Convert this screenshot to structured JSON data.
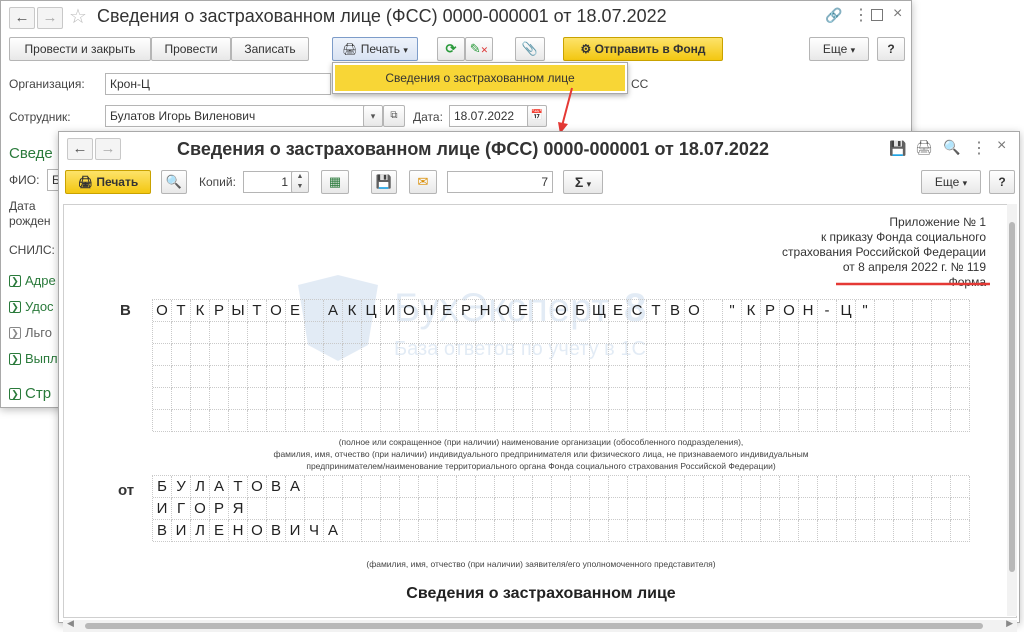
{
  "back_window": {
    "title": "Сведения о застрахованном лице (ФСС) 0000-000001 от 18.07.2022",
    "toolbar": {
      "post_close": "Провести и закрыть",
      "post": "Провести",
      "save": "Записать",
      "print": "Печать",
      "send_fund": "Отправить в Фонд",
      "more": "Еще",
      "help": "?"
    },
    "print_menu_item": "Сведения о застрахованном лице",
    "org_label": "Организация:",
    "org_value": "Крон-Ц",
    "org_suffix": "СС",
    "employee_label": "Сотрудник:",
    "employee_value": "Булатов Игорь Виленович",
    "date_label": "Дата:",
    "date_value": "18.07.2022",
    "section_title": "Сведе",
    "fio_label": "ФИО:",
    "fio_value": "Б",
    "birth_label_1": "Дата",
    "birth_label_2": "рожден",
    "snils_label": "СНИЛС:",
    "links": [
      "Адре",
      "Удос",
      "Льго",
      "Выпл",
      "Стр"
    ]
  },
  "front_window": {
    "title": "Сведения о застрахованном лице (ФСС) 0000-000001 от 18.07.2022",
    "toolbar": {
      "print": "Печать",
      "copies_label": "Копий:",
      "copies_value": "1",
      "page_value": "7",
      "sum_symbol": "Σ",
      "more": "Еще",
      "help": "?"
    },
    "document": {
      "appendix_lines": [
        "Приложение № 1",
        "к приказу Фонда социального",
        "страхования Российской Федерации",
        "от 8 апреля 2022 г. № 119",
        "Форма"
      ],
      "to_letter": "В",
      "from_letter": "от",
      "org_name_chars": [
        "О",
        "Т",
        "К",
        "Р",
        "Ы",
        "Т",
        "О",
        "Е",
        "",
        "А",
        "К",
        "Ц",
        "И",
        "О",
        "Н",
        "Е",
        "Р",
        "Н",
        "О",
        "Е",
        "",
        "О",
        "Б",
        "Щ",
        "Е",
        "С",
        "Т",
        "В",
        "О",
        "",
        "\"",
        "К",
        "Р",
        "О",
        "Н",
        "-",
        "Ц",
        "\""
      ],
      "org_caption_lines": [
        "(полное или сокращенное (при наличии) наименование организации (обособленного подразделения),",
        "фамилия, имя, отчество (при наличии) индивидуального предпринимателя или физического лица, не признаваемого индивидуальным",
        "предпринимателем/наименование территориального органа Фонда социального страхования Российской Федерации)"
      ],
      "surname_chars": [
        "Б",
        "У",
        "Л",
        "А",
        "Т",
        "О",
        "В",
        "А"
      ],
      "name_chars": [
        "И",
        "Г",
        "О",
        "Р",
        "Я"
      ],
      "patronymic_chars": [
        "В",
        "И",
        "Л",
        "Е",
        "Н",
        "О",
        "В",
        "И",
        "Ч",
        "А"
      ],
      "applicant_caption": "(фамилия, имя, отчество (при наличии) заявителя/его уполномоченного представителя)",
      "heading": "Сведения о застрахованном лице",
      "watermark_title": "БухЭксперт",
      "watermark_num": "8",
      "watermark_sub": "База ответов по учету в 1С"
    }
  },
  "colors": {
    "accent_yellow": "#f8d636",
    "link_green": "#2a7a3b",
    "annotation_red": "#e53935"
  }
}
